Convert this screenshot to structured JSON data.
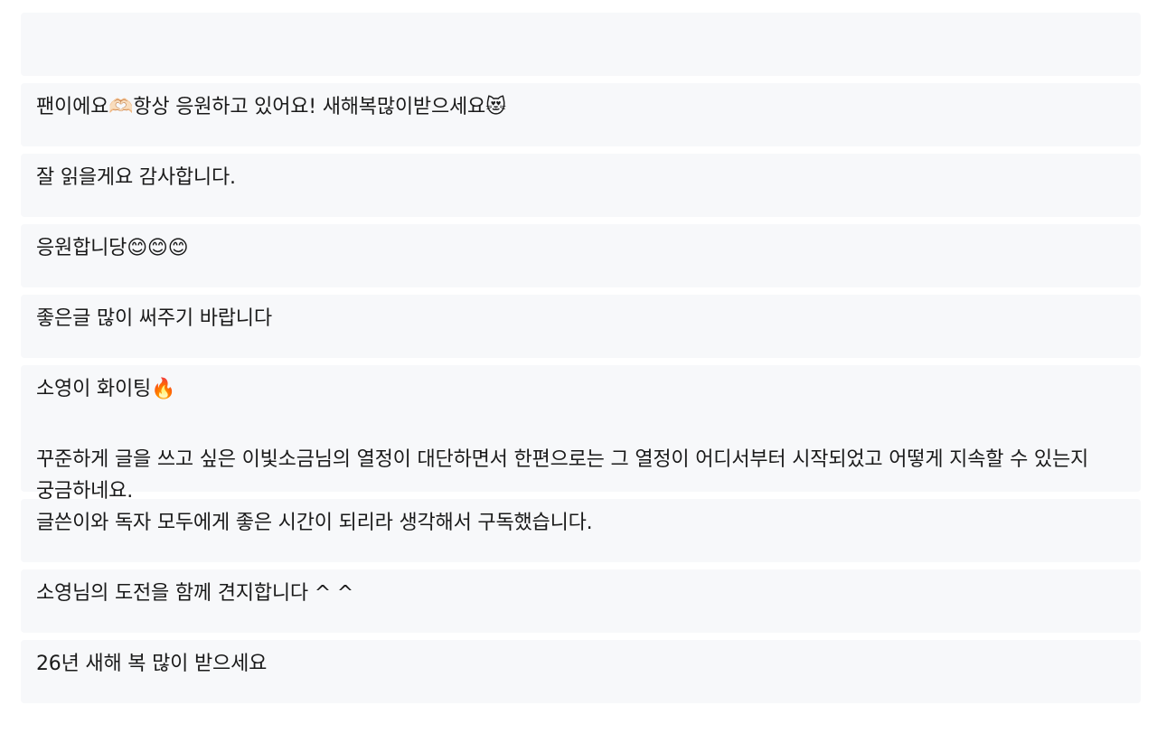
{
  "comments": [
    {
      "text": "팬이에요🫶🏻항상 응원하고 있어요! 새해복많이받으세요😻"
    },
    {
      "text": "잘 읽을게요 감사합니다."
    },
    {
      "text": "응원합니당😊😊😊"
    },
    {
      "text": "좋은글 많이 써주기 바랍니다"
    },
    {
      "text": "소영이 화이팅🔥"
    },
    {
      "text": "꾸준하게 글을 쓰고 싶은 이빛소금님의 열정이 대단하면서 한편으로는 그 열정이 어디서부터 시작되었고 어떻게 지속할 수 있는지 궁금하네요.\n글쓴이와 독자 모두에게 좋은 시간이 되리라 생각해서 구독했습니다."
    },
    {
      "text": "소영님의 도전을 함께 견지합니다 ^ ^"
    },
    {
      "text": "26년 새해 복 많이 받으세요"
    }
  ]
}
